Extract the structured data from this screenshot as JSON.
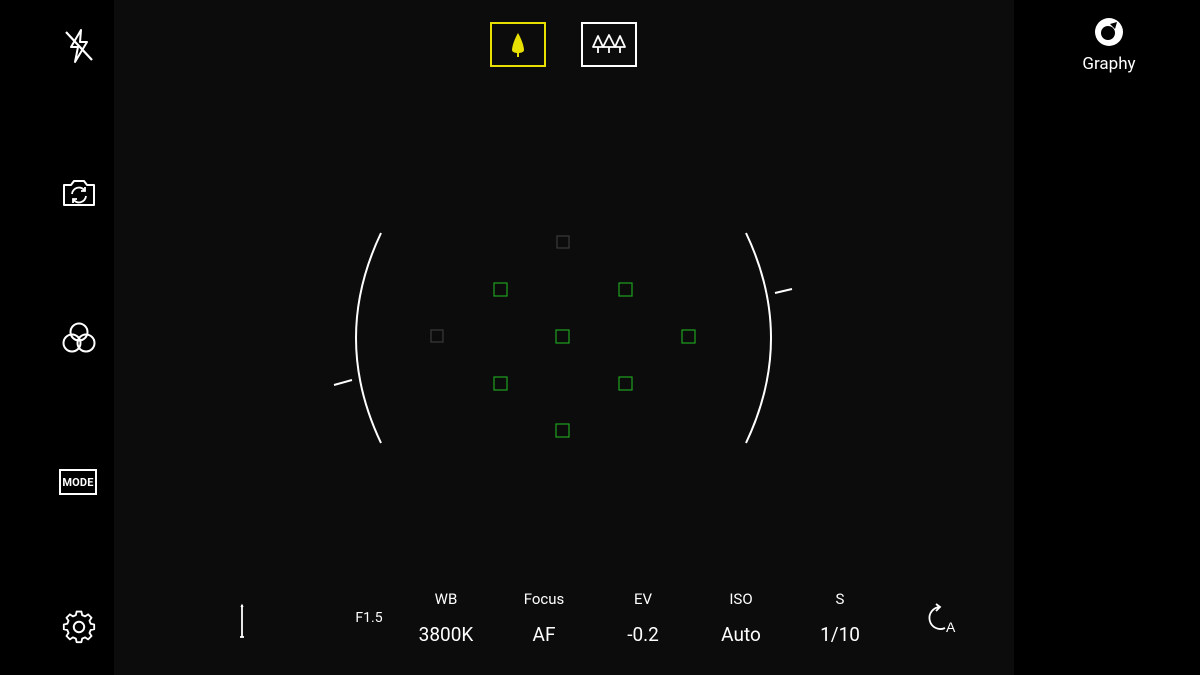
{
  "left_toolbar": {
    "flash_icon": "flash-off-icon",
    "switch_camera_icon": "camera-switch-icon",
    "filters_icon": "filters-icon",
    "mode_label": "MODE",
    "settings_icon": "gear-icon"
  },
  "scene": {
    "single_icon": "single-tree-icon",
    "landscape_icon": "multi-tree-icon",
    "active": "single",
    "active_color": "#e8e000"
  },
  "graphy": {
    "label": "Graphy",
    "icon": "graphy-lens-icon"
  },
  "focus_grid": {
    "active_color": "#1fa31f",
    "inactive_color": "#3a3a3a"
  },
  "controls": {
    "aperture": "F1.5",
    "params": [
      {
        "label": "WB",
        "value": "3800K"
      },
      {
        "label": "Focus",
        "value": "AF"
      },
      {
        "label": "EV",
        "value": "-0.2"
      },
      {
        "label": "ISO",
        "value": "Auto"
      },
      {
        "label": "S",
        "value": "1/10"
      }
    ],
    "auto_rotate_icon": "auto-rotate-icon",
    "auto_rotate_letter": "A"
  }
}
